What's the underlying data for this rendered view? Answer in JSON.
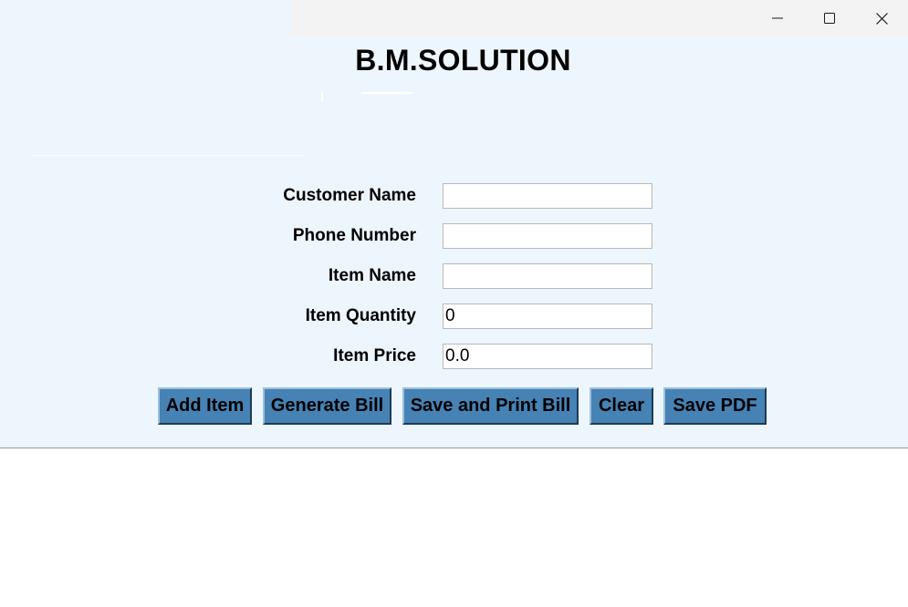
{
  "window": {
    "minimize_icon": "minimize-icon",
    "maximize_icon": "maximize-icon",
    "close_icon": "close-icon"
  },
  "header": {
    "title": "B.M.SOLUTION"
  },
  "form": {
    "customer_name": {
      "label": "Customer Name",
      "value": ""
    },
    "phone_number": {
      "label": "Phone Number",
      "value": ""
    },
    "item_name": {
      "label": "Item Name",
      "value": ""
    },
    "item_quantity": {
      "label": "Item Quantity",
      "value": "0"
    },
    "item_price": {
      "label": "Item Price",
      "value": "0.0"
    }
  },
  "buttons": {
    "add_item": "Add Item",
    "generate_bill": "Generate Bill",
    "save_print_bill": "Save and Print Bill",
    "clear": "Clear",
    "save_pdf": "Save PDF"
  },
  "colors": {
    "app_background": "#eef6fd",
    "button_background": "#4682b4",
    "titlebar_background": "#f3f3f3"
  }
}
